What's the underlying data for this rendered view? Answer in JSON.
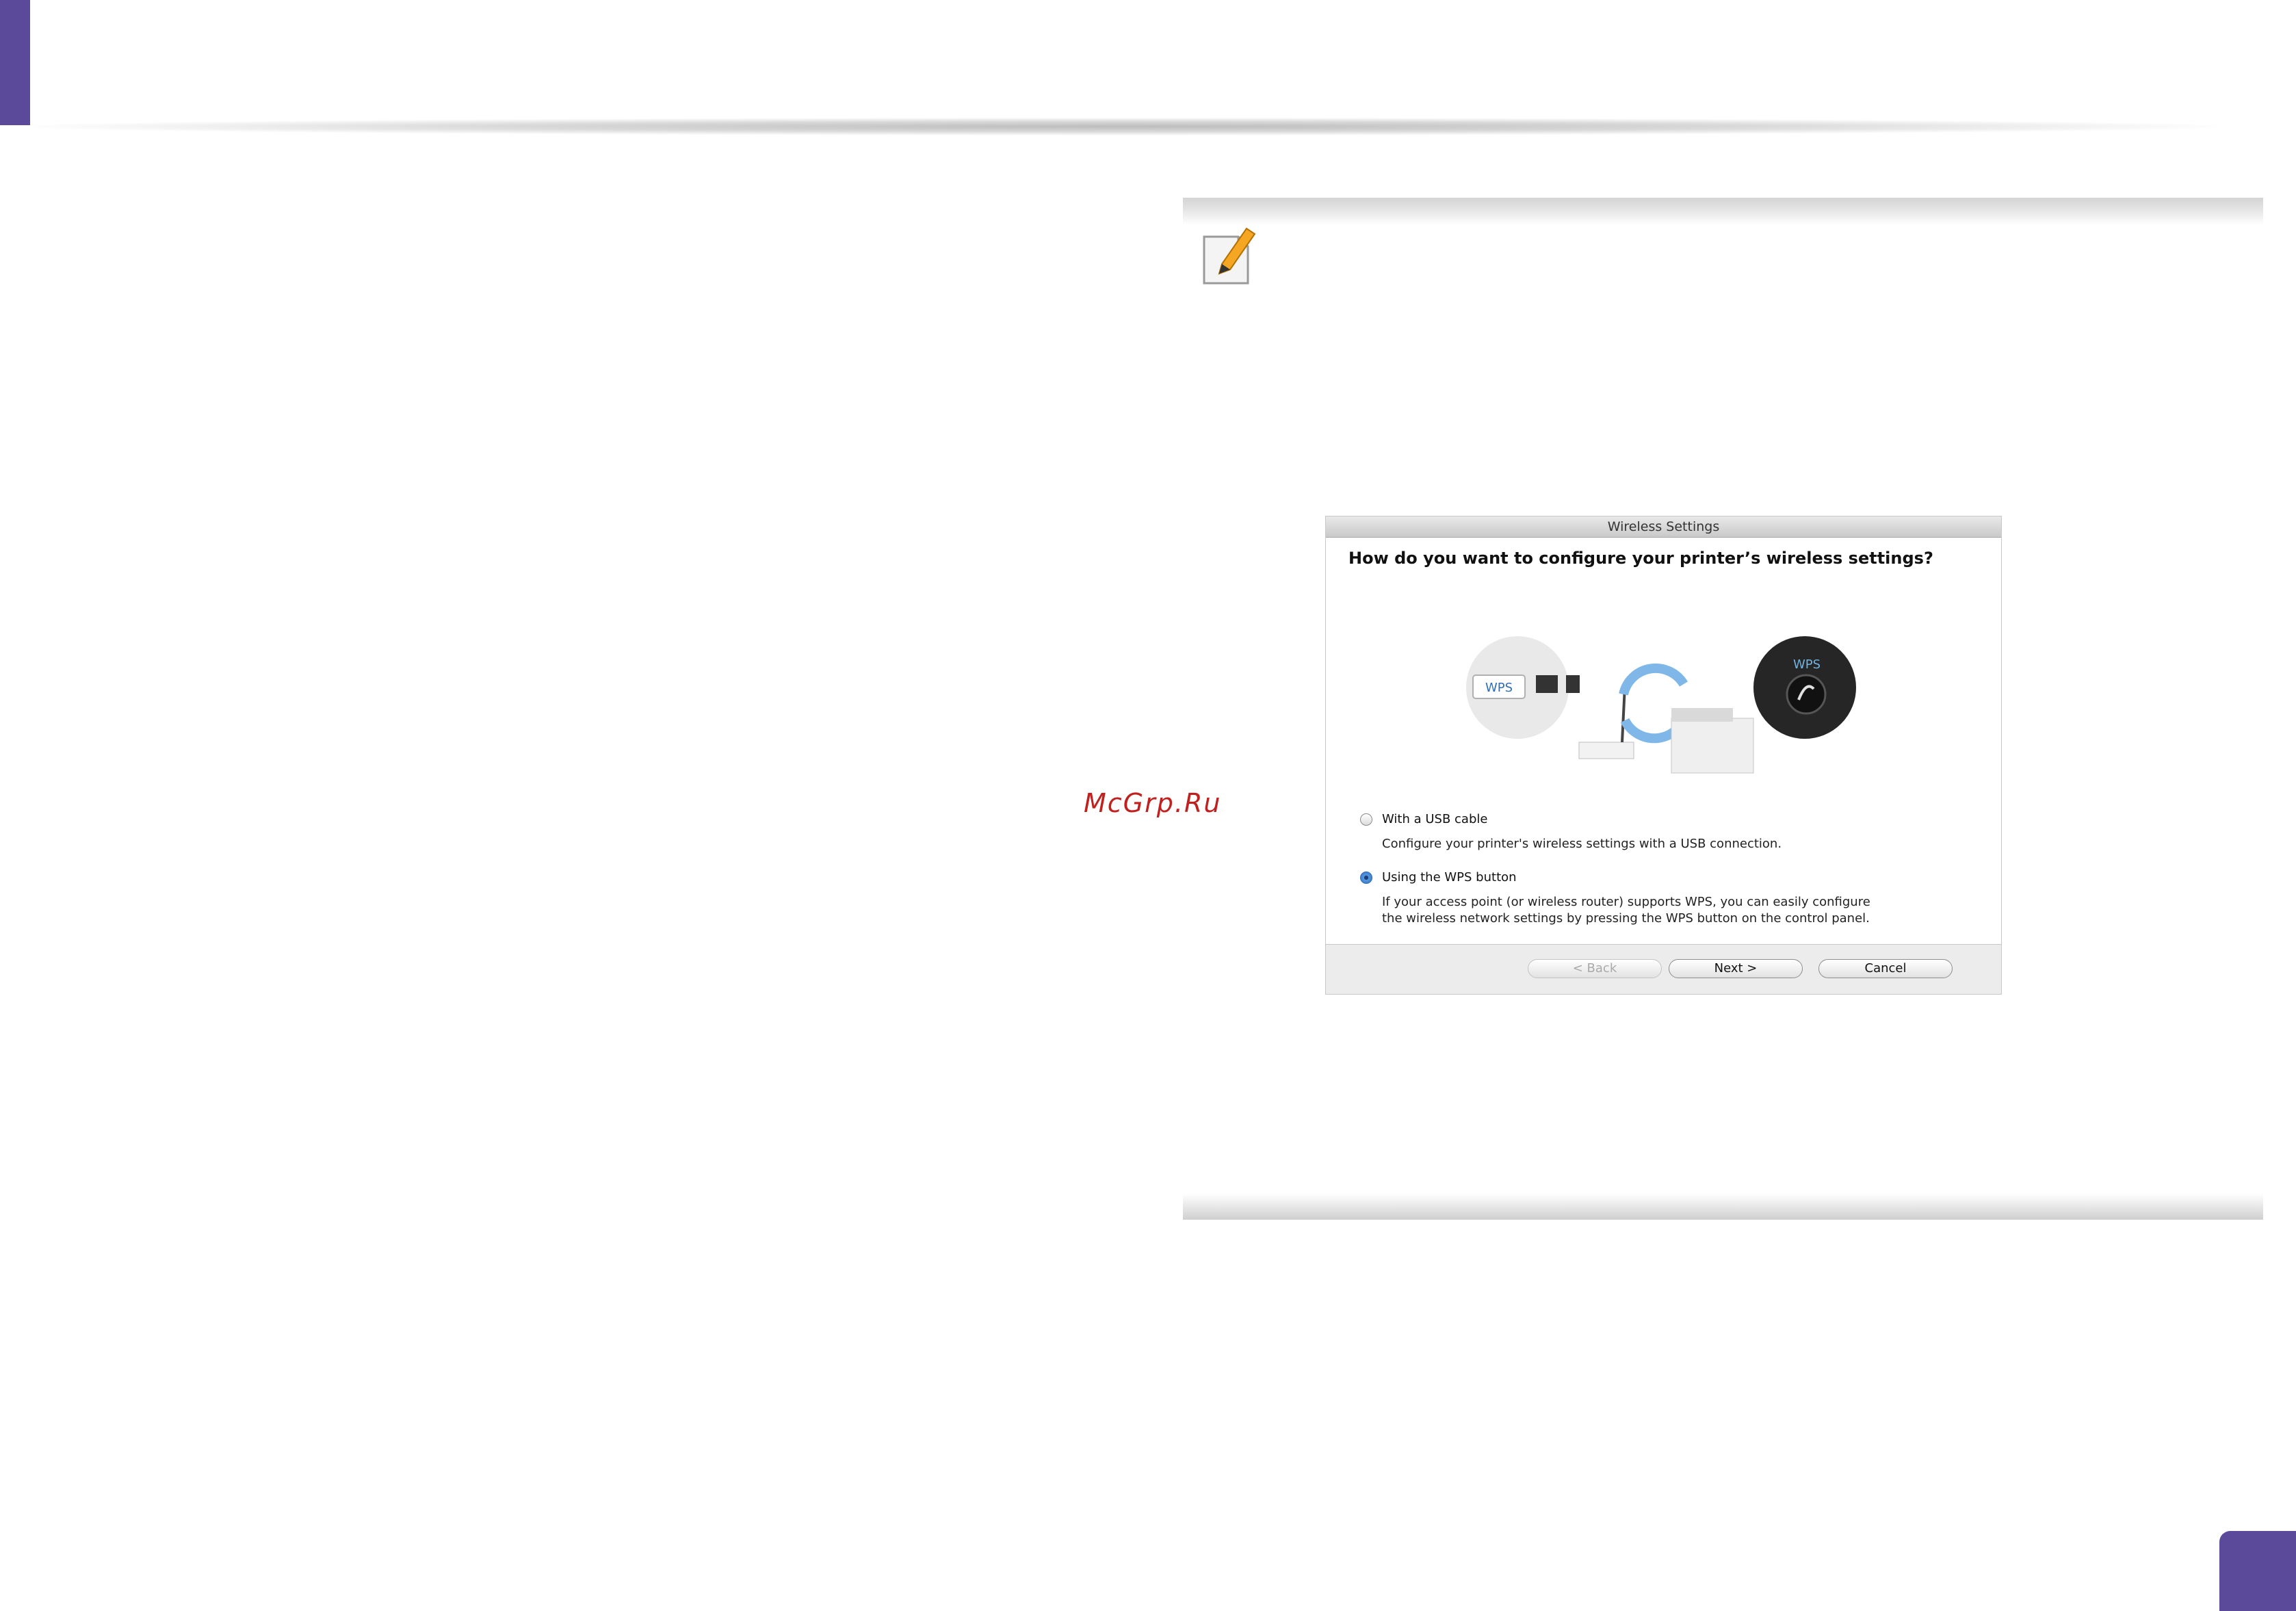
{
  "watermark": "McGrp.Ru",
  "dialog": {
    "title": "Wireless Settings",
    "question": "How do you want to configure your printer’s wireless settings?",
    "illustration": {
      "wps_tag": "WPS",
      "wps_button_label": "WPS"
    },
    "options": [
      {
        "label": "With a USB cable",
        "description_lines": [
          "Configure your printer's wireless settings with a USB connection."
        ],
        "selected": false
      },
      {
        "label": "Using the WPS button",
        "description_lines": [
          "If your access point (or wireless router) supports WPS, you can easily configure",
          "the wireless network settings by pressing the WPS button on the control panel."
        ],
        "selected": true
      }
    ],
    "buttons": {
      "back": "< Back",
      "next": "Next >",
      "cancel": "Cancel"
    }
  },
  "colors": {
    "accent_purple": "#5b4a9a",
    "watermark_red": "#c0211f",
    "radio_selected_blue": "#2e6bbd"
  }
}
